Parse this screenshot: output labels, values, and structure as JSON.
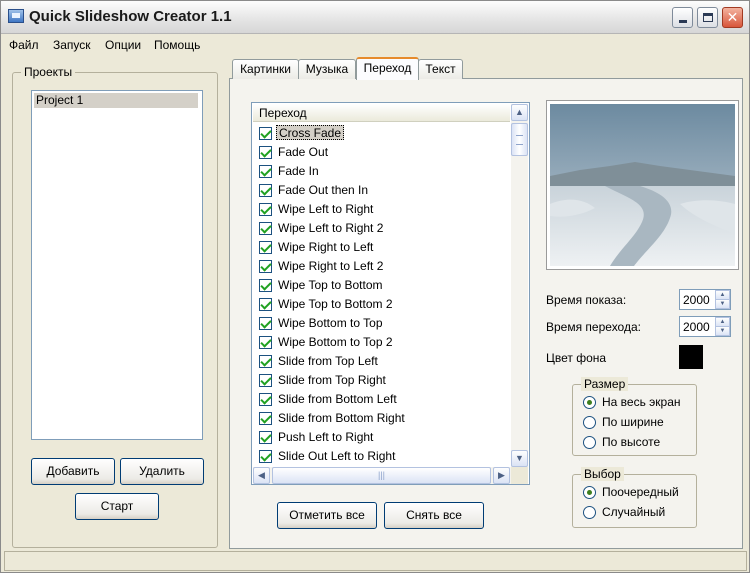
{
  "window": {
    "title": "Quick Slideshow Creator 1.1"
  },
  "menu": [
    "Файл",
    "Запуск",
    "Опции",
    "Помощь"
  ],
  "projects": {
    "group_label": "Проекты",
    "items": [
      "Project 1"
    ],
    "add_button": "Добавить",
    "delete_button": "Удалить",
    "start_button": "Старт"
  },
  "tabs": [
    "Картинки",
    "Музыка",
    "Переход",
    "Текст"
  ],
  "active_tab": "Переход",
  "transitions": {
    "header": "Переход",
    "items": [
      {
        "label": "Cross Fade",
        "checked": true,
        "selected": true
      },
      {
        "label": "Fade Out",
        "checked": true
      },
      {
        "label": "Fade In",
        "checked": true
      },
      {
        "label": "Fade Out then In",
        "checked": true
      },
      {
        "label": "Wipe Left to Right",
        "checked": true
      },
      {
        "label": "Wipe Left to Right 2",
        "checked": true
      },
      {
        "label": "Wipe Right to Left",
        "checked": true
      },
      {
        "label": "Wipe Right to Left 2",
        "checked": true
      },
      {
        "label": "Wipe Top to Bottom",
        "checked": true
      },
      {
        "label": "Wipe Top to Bottom 2",
        "checked": true
      },
      {
        "label": "Wipe Bottom to Top",
        "checked": true
      },
      {
        "label": "Wipe Bottom to Top 2",
        "checked": true
      },
      {
        "label": "Slide from Top Left",
        "checked": true
      },
      {
        "label": "Slide from Top Right",
        "checked": true
      },
      {
        "label": "Slide from Bottom Left",
        "checked": true
      },
      {
        "label": "Slide from Bottom Right",
        "checked": true
      },
      {
        "label": "Push Left to Right",
        "checked": true
      },
      {
        "label": "Slide Out Left to Right",
        "checked": true
      }
    ],
    "check_all_button": "Отметить все",
    "uncheck_all_button": "Снять все"
  },
  "settings": {
    "show_time_label": "Время показа:",
    "show_time_value": "2000",
    "transition_time_label": "Время перехода:",
    "transition_time_value": "2000",
    "bg_color_label": "Цвет фона",
    "bg_color": "#000000"
  },
  "size_group": {
    "label": "Размер",
    "options": [
      "На весь экран",
      "По ширине",
      "По высоте"
    ],
    "selected": 0
  },
  "order_group": {
    "label": "Выбор",
    "options": [
      "Поочередный",
      "Случайный"
    ],
    "selected": 0
  },
  "icons": {
    "app": "slideshow-app-icon",
    "minimize": "minimize-icon",
    "maximize": "maximize-icon",
    "close": "close-icon"
  }
}
